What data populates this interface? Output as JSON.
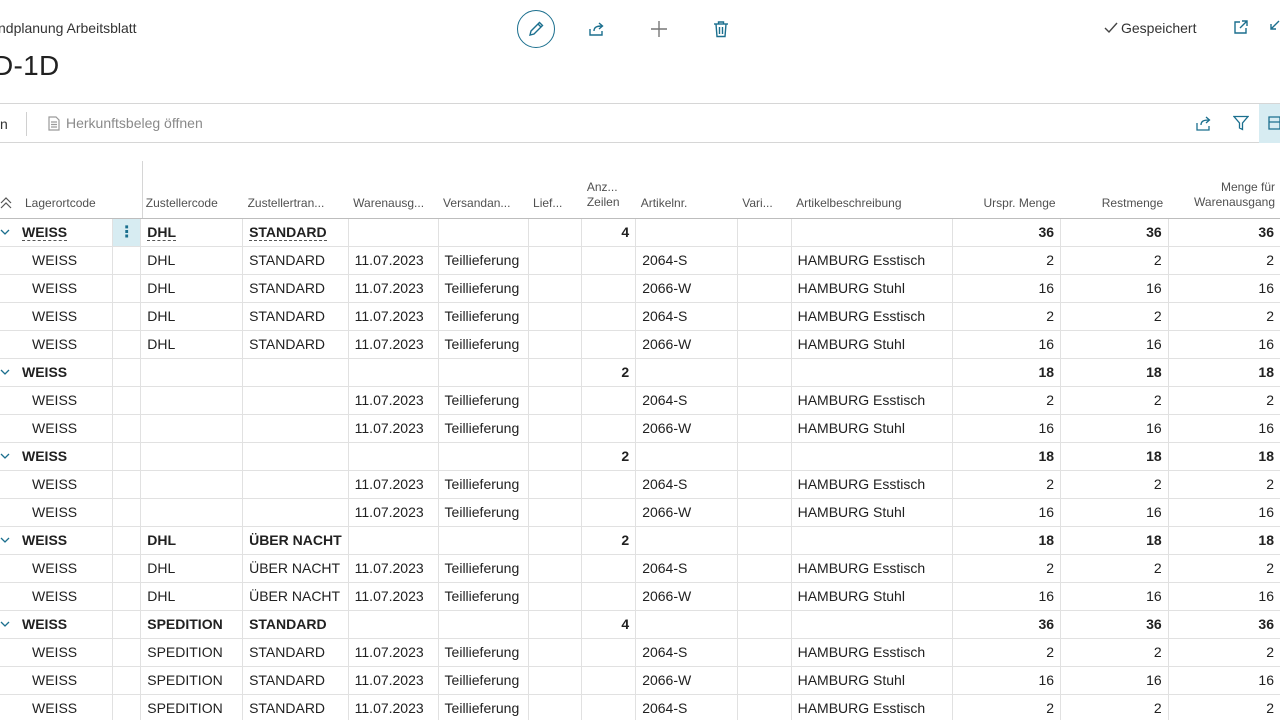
{
  "header": {
    "breadcrumb": "ndplanung Arbeitsblatt",
    "title": "D-1D",
    "saved_label": "Gespeichert"
  },
  "actions": {
    "left_text": "n",
    "open_source_doc": "Herkunftsbeleg öffnen"
  },
  "colors": {
    "accent": "#1b6f8e",
    "selected_bg": "#d7ecf2"
  },
  "icons": [
    "edit-icon",
    "share-icon",
    "add-icon",
    "delete-icon",
    "checkmark-icon",
    "open-new-window-icon",
    "collapse-icon",
    "document-icon",
    "filter-icon",
    "layout-icon",
    "chevron-down-icon",
    "sort-icon",
    "more-options-icon"
  ],
  "table": {
    "columns": {
      "lagerortcode": "Lagerortcode",
      "zustellercode": "Zustellercode",
      "zustellertransport": "Zustellertran...",
      "warenausgang": "Warenausg...",
      "versandanweisung": "Versandan...",
      "lieferung": "Lief...",
      "anzahl_zeilen": "Anz... Zeilen",
      "artikelnr": "Artikelnr.",
      "variante": "Vari...",
      "artikelbeschreibung": "Artikelbeschreibung",
      "urspr_menge": "Urspr. Menge",
      "restmenge": "Restmenge",
      "menge_warenausgang": "Menge für Warenausgang"
    },
    "rows": [
      {
        "group": true,
        "lager": "WEISS",
        "zust": "DHL",
        "trans": "STANDARD",
        "datum": "",
        "versand": "",
        "lief": "",
        "anz": "4",
        "art": "",
        "var": "",
        "beschr": "",
        "urspr": "36",
        "rest": "36",
        "wa": "36",
        "active": true
      },
      {
        "group": false,
        "lager": "WEISS",
        "zust": "DHL",
        "trans": "STANDARD",
        "datum": "11.07.2023",
        "versand": "Teillieferung",
        "lief": "",
        "anz": "",
        "art": "2064-S",
        "var": "",
        "beschr": "HAMBURG Esstisch",
        "urspr": "2",
        "rest": "2",
        "wa": "2"
      },
      {
        "group": false,
        "lager": "WEISS",
        "zust": "DHL",
        "trans": "STANDARD",
        "datum": "11.07.2023",
        "versand": "Teillieferung",
        "lief": "",
        "anz": "",
        "art": "2066-W",
        "var": "",
        "beschr": "HAMBURG Stuhl",
        "urspr": "16",
        "rest": "16",
        "wa": "16"
      },
      {
        "group": false,
        "lager": "WEISS",
        "zust": "DHL",
        "trans": "STANDARD",
        "datum": "11.07.2023",
        "versand": "Teillieferung",
        "lief": "",
        "anz": "",
        "art": "2064-S",
        "var": "",
        "beschr": "HAMBURG Esstisch",
        "urspr": "2",
        "rest": "2",
        "wa": "2"
      },
      {
        "group": false,
        "lager": "WEISS",
        "zust": "DHL",
        "trans": "STANDARD",
        "datum": "11.07.2023",
        "versand": "Teillieferung",
        "lief": "",
        "anz": "",
        "art": "2066-W",
        "var": "",
        "beschr": "HAMBURG Stuhl",
        "urspr": "16",
        "rest": "16",
        "wa": "16"
      },
      {
        "group": true,
        "lager": "WEISS",
        "zust": "",
        "trans": "",
        "datum": "",
        "versand": "",
        "lief": "",
        "anz": "2",
        "art": "",
        "var": "",
        "beschr": "",
        "urspr": "18",
        "rest": "18",
        "wa": "18"
      },
      {
        "group": false,
        "lager": "WEISS",
        "zust": "",
        "trans": "",
        "datum": "11.07.2023",
        "versand": "Teillieferung",
        "lief": "",
        "anz": "",
        "art": "2064-S",
        "var": "",
        "beschr": "HAMBURG Esstisch",
        "urspr": "2",
        "rest": "2",
        "wa": "2"
      },
      {
        "group": false,
        "lager": "WEISS",
        "zust": "",
        "trans": "",
        "datum": "11.07.2023",
        "versand": "Teillieferung",
        "lief": "",
        "anz": "",
        "art": "2066-W",
        "var": "",
        "beschr": "HAMBURG Stuhl",
        "urspr": "16",
        "rest": "16",
        "wa": "16"
      },
      {
        "group": true,
        "lager": "WEISS",
        "zust": "",
        "trans": "",
        "datum": "",
        "versand": "",
        "lief": "",
        "anz": "2",
        "art": "",
        "var": "",
        "beschr": "",
        "urspr": "18",
        "rest": "18",
        "wa": "18"
      },
      {
        "group": false,
        "lager": "WEISS",
        "zust": "",
        "trans": "",
        "datum": "11.07.2023",
        "versand": "Teillieferung",
        "lief": "",
        "anz": "",
        "art": "2064-S",
        "var": "",
        "beschr": "HAMBURG Esstisch",
        "urspr": "2",
        "rest": "2",
        "wa": "2"
      },
      {
        "group": false,
        "lager": "WEISS",
        "zust": "",
        "trans": "",
        "datum": "11.07.2023",
        "versand": "Teillieferung",
        "lief": "",
        "anz": "",
        "art": "2066-W",
        "var": "",
        "beschr": "HAMBURG Stuhl",
        "urspr": "16",
        "rest": "16",
        "wa": "16"
      },
      {
        "group": true,
        "lager": "WEISS",
        "zust": "DHL",
        "trans": "ÜBER NACHT",
        "datum": "",
        "versand": "",
        "lief": "",
        "anz": "2",
        "art": "",
        "var": "",
        "beschr": "",
        "urspr": "18",
        "rest": "18",
        "wa": "18"
      },
      {
        "group": false,
        "lager": "WEISS",
        "zust": "DHL",
        "trans": "ÜBER NACHT",
        "datum": "11.07.2023",
        "versand": "Teillieferung",
        "lief": "",
        "anz": "",
        "art": "2064-S",
        "var": "",
        "beschr": "HAMBURG Esstisch",
        "urspr": "2",
        "rest": "2",
        "wa": "2"
      },
      {
        "group": false,
        "lager": "WEISS",
        "zust": "DHL",
        "trans": "ÜBER NACHT",
        "datum": "11.07.2023",
        "versand": "Teillieferung",
        "lief": "",
        "anz": "",
        "art": "2066-W",
        "var": "",
        "beschr": "HAMBURG Stuhl",
        "urspr": "16",
        "rest": "16",
        "wa": "16"
      },
      {
        "group": true,
        "lager": "WEISS",
        "zust": "SPEDITION",
        "trans": "STANDARD",
        "datum": "",
        "versand": "",
        "lief": "",
        "anz": "4",
        "art": "",
        "var": "",
        "beschr": "",
        "urspr": "36",
        "rest": "36",
        "wa": "36"
      },
      {
        "group": false,
        "lager": "WEISS",
        "zust": "SPEDITION",
        "trans": "STANDARD",
        "datum": "11.07.2023",
        "versand": "Teillieferung",
        "lief": "",
        "anz": "",
        "art": "2064-S",
        "var": "",
        "beschr": "HAMBURG Esstisch",
        "urspr": "2",
        "rest": "2",
        "wa": "2"
      },
      {
        "group": false,
        "lager": "WEISS",
        "zust": "SPEDITION",
        "trans": "STANDARD",
        "datum": "11.07.2023",
        "versand": "Teillieferung",
        "lief": "",
        "anz": "",
        "art": "2066-W",
        "var": "",
        "beschr": "HAMBURG Stuhl",
        "urspr": "16",
        "rest": "16",
        "wa": "16"
      },
      {
        "group": false,
        "lager": "WEISS",
        "zust": "SPEDITION",
        "trans": "STANDARD",
        "datum": "11.07.2023",
        "versand": "Teillieferung",
        "lief": "",
        "anz": "",
        "art": "2064-S",
        "var": "",
        "beschr": "HAMBURG Esstisch",
        "urspr": "2",
        "rest": "2",
        "wa": "2"
      }
    ]
  }
}
